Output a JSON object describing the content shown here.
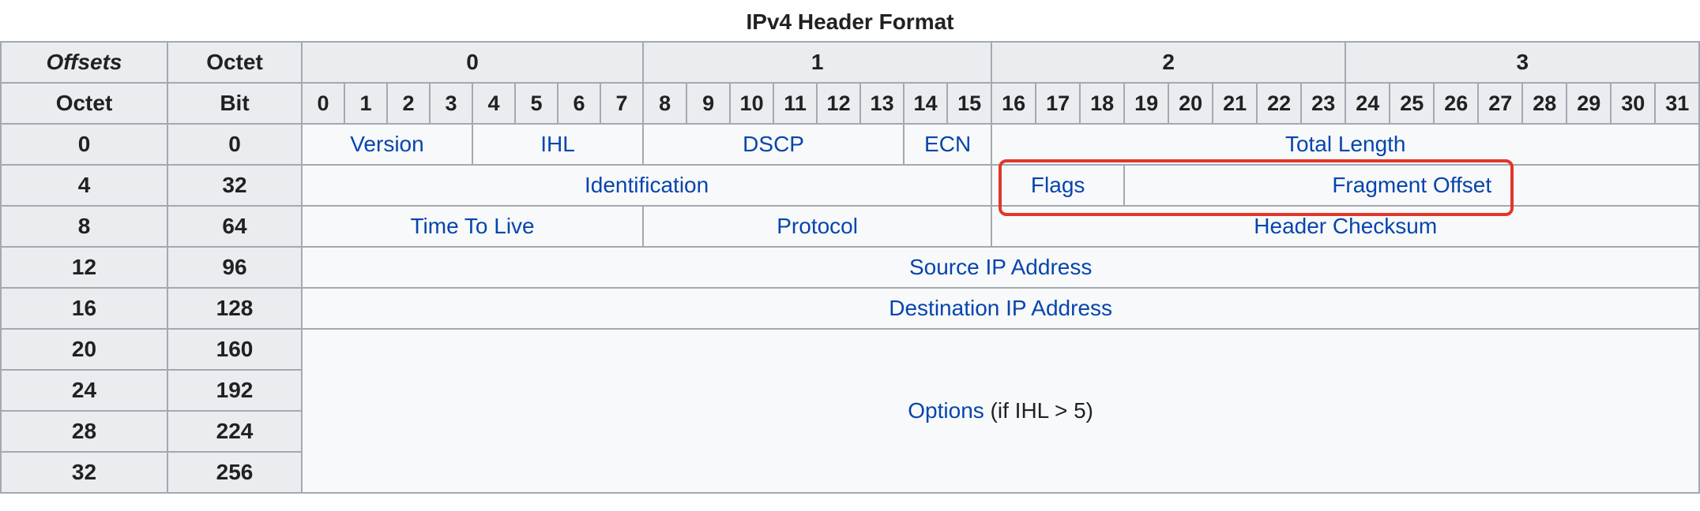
{
  "caption": "IPv4 Header Format",
  "header": {
    "offsets": "Offsets",
    "octet_col": "Octet",
    "octet_row": "Octet",
    "bit": "Bit",
    "octet_numbers": [
      "0",
      "1",
      "2",
      "3"
    ],
    "bit_numbers": [
      "0",
      "1",
      "2",
      "3",
      "4",
      "5",
      "6",
      "7",
      "8",
      "9",
      "10",
      "11",
      "12",
      "13",
      "14",
      "15",
      "16",
      "17",
      "18",
      "19",
      "20",
      "21",
      "22",
      "23",
      "24",
      "25",
      "26",
      "27",
      "28",
      "29",
      "30",
      "31"
    ]
  },
  "rows": {
    "r0": {
      "octet": "0",
      "bit": "0",
      "version": "Version",
      "ihl": "IHL",
      "dscp": "DSCP",
      "ecn": "ECN",
      "total_length": "Total Length"
    },
    "r1": {
      "octet": "4",
      "bit": "32",
      "identification": "Identification",
      "flags": "Flags",
      "fragment_offset": "Fragment Offset"
    },
    "r2": {
      "octet": "8",
      "bit": "64",
      "ttl": "Time To Live",
      "protocol": "Protocol",
      "header_checksum": "Header Checksum"
    },
    "r3": {
      "octet": "12",
      "bit": "96",
      "source_ip": "Source IP Address"
    },
    "r4": {
      "octet": "16",
      "bit": "128",
      "destination_ip": "Destination IP Address"
    },
    "r5": {
      "octet": "20",
      "bit": "160"
    },
    "r6": {
      "octet": "24",
      "bit": "192"
    },
    "r7": {
      "octet": "28",
      "bit": "224"
    },
    "r8": {
      "octet": "32",
      "bit": "256"
    },
    "options": {
      "link": "Options",
      "note": " (if IHL > 5)"
    }
  },
  "colors": {
    "link": "#0645ad",
    "header_bg": "#eaecf0",
    "cell_bg": "#f8f9fa",
    "border": "#a2a9b1",
    "highlight": "#e0372a"
  }
}
